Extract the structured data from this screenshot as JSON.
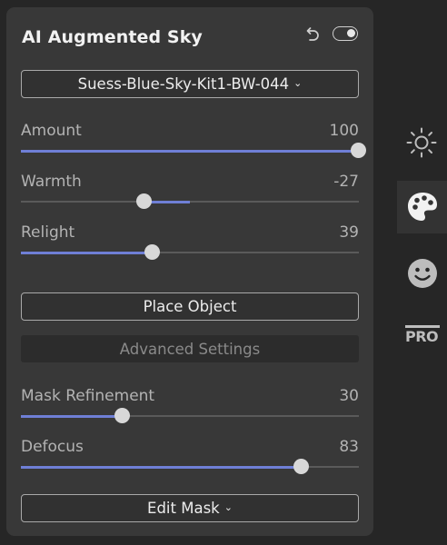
{
  "panel": {
    "title": "AI Augmented Sky",
    "preset": {
      "label": "Suess-Blue-Sky-Kit1-BW-044",
      "caret": "⌄"
    },
    "sliders": [
      {
        "label": "Amount",
        "value": "100",
        "percent": 100,
        "bipolar": false
      },
      {
        "label": "Warmth",
        "value": "-27",
        "percent": 36.5,
        "bipolar": true
      },
      {
        "label": "Relight",
        "value": "39",
        "percent": 39,
        "bipolar": false
      }
    ],
    "place_object": "Place Object",
    "advanced_settings": "Advanced Settings",
    "mask_sliders": [
      {
        "label": "Mask Refinement",
        "value": "30",
        "percent": 30,
        "bipolar": false
      },
      {
        "label": "Defocus",
        "value": "83",
        "percent": 83,
        "bipolar": false
      }
    ],
    "edit_mask": {
      "label": "Edit Mask",
      "caret": "⌄"
    }
  },
  "sidebar": {
    "items": [
      {
        "icon": "sun-icon",
        "active": false
      },
      {
        "icon": "palette-icon",
        "active": true
      },
      {
        "icon": "smiley-face-icon",
        "active": false
      },
      {
        "icon": "pro-icon",
        "label": "PRO",
        "active": false
      }
    ]
  },
  "colors": {
    "accent": "#6f7fd6",
    "panel_bg": "#383838",
    "app_bg": "#262626"
  }
}
